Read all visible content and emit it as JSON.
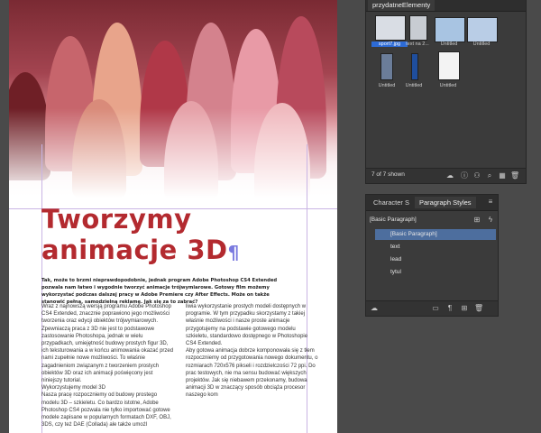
{
  "document": {
    "title_line1": "Tworzymy",
    "title_line2": "animacje 3D",
    "title_mark_pilcrow": "¶",
    "lead": "Tak, może to brzmi nieprawdopodobnie, jednak program Adobe Photoshop CS4 Extended pozwala nam łatwo i wygodnie tworzyć animacje trójwymiarowe. Gotowy film możemy wykorzystać podczas dalszej pracy w Adobe Premiere czy After Effects. Może on także stanowić pełną, samodzielną reklamę. Jak się za to zabrać?",
    "column1": "Wraz z najnowszą wersją programu Adobe Photoshop CS4 Extended, znacznie poprawiono jego możliwości tworzenia oraz edycji obiektów trójwymiarowych. Zpewniaczą praca z 3D nie jest to podstawowe zastosowanie Photoshopa, jednak w wielu przypadkach, umiejętność budowy prostych figur 3D, ich teksturowania a w końcu animowania okazać przed nami zupełnie nowe możliwości. To właśnie zagadnieniom związanym z tworzeniem prostych obiektów 3D oraz ich animacji poświęcony jest niniejszy tutorial.\nWykorzystujemy model 3D\nNasza pracę rozpoczniemy od budowy prostego modelu 3D – szkieletu. Co bardzo istotne, Adobe Photoshop CS4 pozwala nie tylko importować gotowe modele zapisane w popularnych formatach DXF, OBJ, 3DS, czy też DAE (Collada) ale także umożl",
    "column2": "liwia wykorzystanie prostych modeli dostępnych w programie. W tym przypadku skorzystamy z takiej właśnie możliwości i nasze proste animacje przygotujemy na podstawie gotowego modelu szkieletu, standardowo dostępnego w Photoshopie CS4 Extended.\nAby gotowa animacja dobrze komponowała się z tłem rozpoczniemy od przygotowania nowego dokumentu, o rozmiarach 720x576 pikseli i rozdzielczości 72 ppi. Do prac testowych, nie ma sensu budować większych projektów. Jak się niebawem przekonamy, budowa animacji 3D w znaczący sposób obciąża procesor naszego kom"
  },
  "links_panel": {
    "tab": "przydatneElementy",
    "items": [
      {
        "label": "sport7.jpg",
        "selected": true
      },
      {
        "label": "text na 2..."
      },
      {
        "label": "Untitled"
      },
      {
        "label": "Untitled"
      },
      {
        "label": "Untitled"
      },
      {
        "label": "Untitled"
      },
      {
        "label": "Untitled"
      }
    ],
    "count": "7 of 7 shown"
  },
  "styles_panel": {
    "tabs": [
      "Character S",
      "Paragraph Styles"
    ],
    "current": "[Basic Paragraph]",
    "items": [
      "[Basic Paragraph]",
      "text",
      "lead",
      "tytul"
    ],
    "selected_index": 0
  },
  "colors": {
    "title": "#b32a2f",
    "selection": "#2d6bd6",
    "panel_bg": "#3b3b3b",
    "guide": "#c9b4e4"
  }
}
